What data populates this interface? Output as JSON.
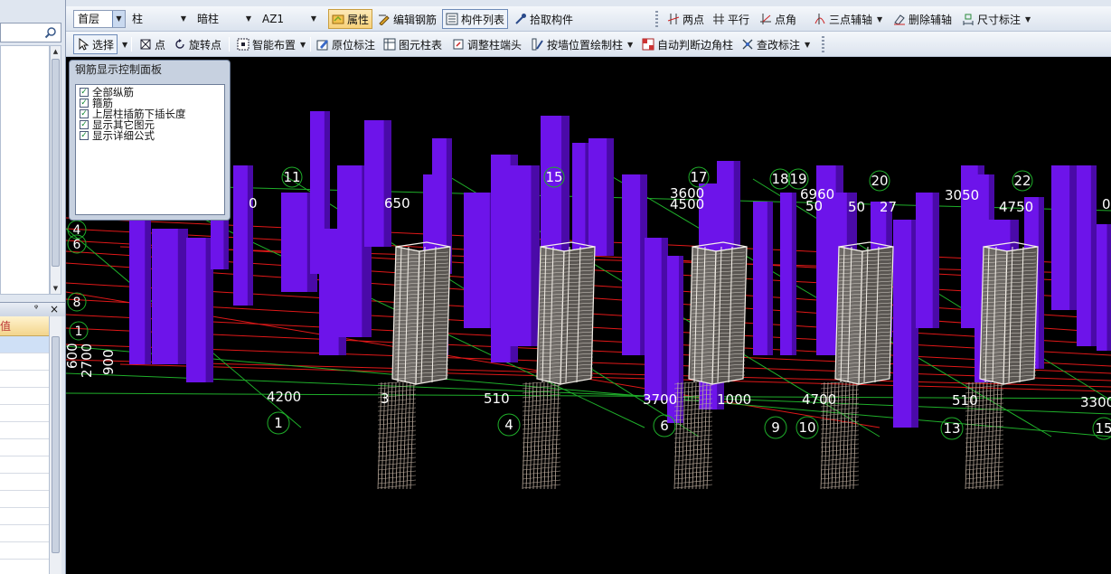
{
  "toolbar1": {
    "floor_combo": "首层",
    "type_combo": "柱",
    "subtype_combo": "暗柱",
    "component_combo": "AZ1",
    "properties": "属性",
    "edit_rebar": "编辑钢筋",
    "component_list": "构件列表",
    "pick_component": "拾取构件",
    "two_point": "两点",
    "parallel": "平行",
    "point_angle": "点角",
    "three_point_axis": "三点辅轴",
    "delete_axis": "删除辅轴",
    "dimension": "尺寸标注"
  },
  "toolbar2": {
    "select": "选择",
    "point": "点",
    "rotate_point": "旋转点",
    "smart_layout": "智能布置",
    "in_place_label": "原位标注",
    "element_column_table": "图元柱表",
    "adjust_column_end": "调整柱端头",
    "draw_by_wall": "按墙位置绘制柱",
    "auto_corner_column": "自动判断边角柱",
    "check_labels": "查改标注"
  },
  "rebar_panel": {
    "title": "钢筋显示控制面板",
    "options": [
      {
        "label": "全部纵筋",
        "checked": true
      },
      {
        "label": "箍筋",
        "checked": true
      },
      {
        "label": "上层柱插筋下插长度",
        "checked": true
      },
      {
        "label": "显示其它图元",
        "checked": true
      },
      {
        "label": "显示详细公式",
        "checked": true
      }
    ]
  },
  "viewport": {
    "axis_numbers_back": [
      "11",
      "15",
      "17",
      "18",
      "19",
      "20",
      "22"
    ],
    "axis_numbers_front": [
      "1",
      "4",
      "6",
      "9",
      "10",
      "13",
      "15"
    ],
    "axis_letters_left": [
      "4",
      "6",
      "8",
      "1"
    ],
    "dims_back": [
      "0",
      "650",
      "3600",
      "4500",
      "6960",
      "50",
      "50",
      "27",
      "3050",
      "4750",
      "0"
    ],
    "dims_front": [
      "4200",
      "3",
      "510",
      "3700",
      "1000",
      "4700",
      "510",
      "3300"
    ],
    "dims_left_vertical": [
      "600",
      "2700",
      "900"
    ]
  },
  "colors": {
    "column": "#6d14ea",
    "column_dark": "#4a0aa8",
    "axis_red": "#e01818",
    "axis_green": "#1fae2a",
    "rebar_white": "#f3efe8",
    "rebar_tan": "#b8a89a"
  }
}
